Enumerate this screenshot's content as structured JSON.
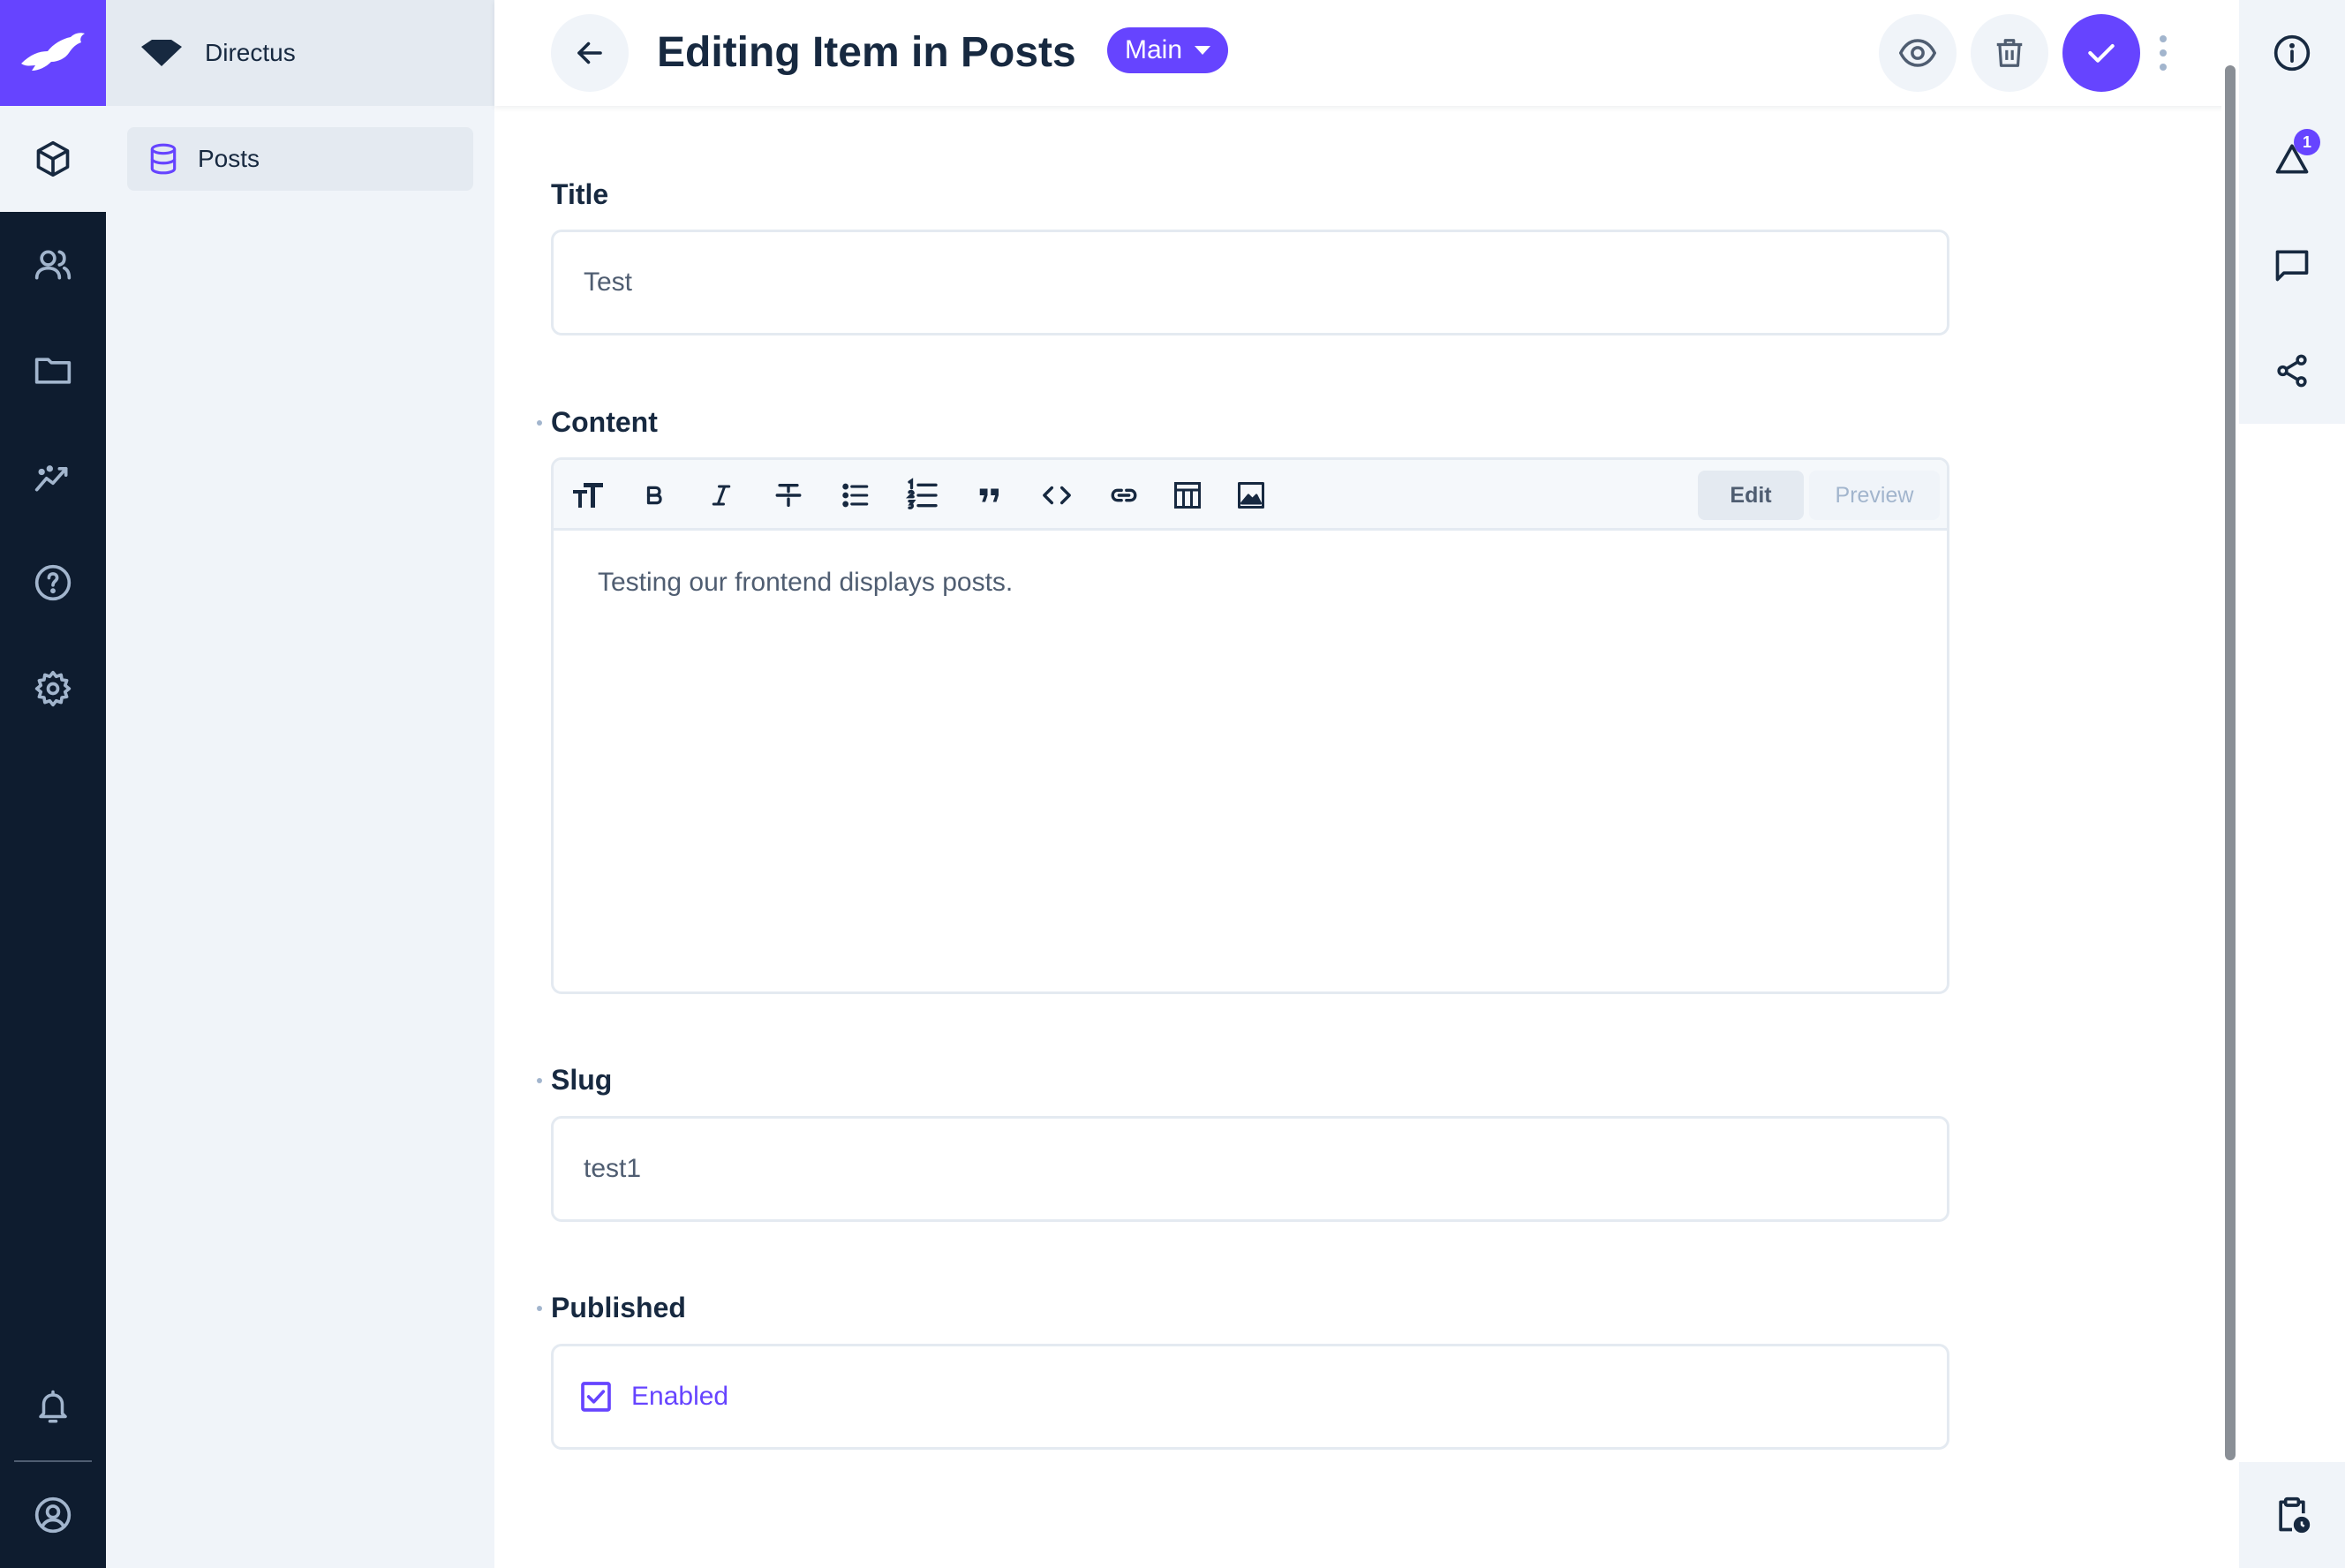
{
  "app": {
    "project_name": "Directus"
  },
  "navigation": {
    "items": [
      {
        "label": "Posts",
        "icon": "database-icon",
        "active": true
      }
    ]
  },
  "module_bar": {
    "items": [
      "content-icon",
      "users-icon",
      "folder-icon",
      "insights-icon",
      "help-icon",
      "settings-icon"
    ],
    "bottom": [
      "notifications-icon",
      "user-icon"
    ]
  },
  "header": {
    "title": "Editing Item in Posts",
    "version_label": "Main"
  },
  "form": {
    "title": {
      "label": "Title",
      "value": "Test"
    },
    "content": {
      "label": "Content",
      "value": "Testing our frontend displays posts.",
      "mode_edit": "Edit",
      "mode_preview": "Preview",
      "toolbar": [
        "heading",
        "bold",
        "italic",
        "strikethrough",
        "bullet-list",
        "numbered-list",
        "blockquote",
        "code",
        "link",
        "table",
        "image"
      ]
    },
    "slug": {
      "label": "Slug",
      "value": "test1"
    },
    "published": {
      "label": "Published",
      "checkbox_label": "Enabled",
      "checked": true
    }
  },
  "sidebar": {
    "revisions_badge": "1"
  },
  "colors": {
    "accent": "#6644ff",
    "dark": "#0e1c2f",
    "panel": "#f0f4f9",
    "border": "#e4eaf1"
  }
}
